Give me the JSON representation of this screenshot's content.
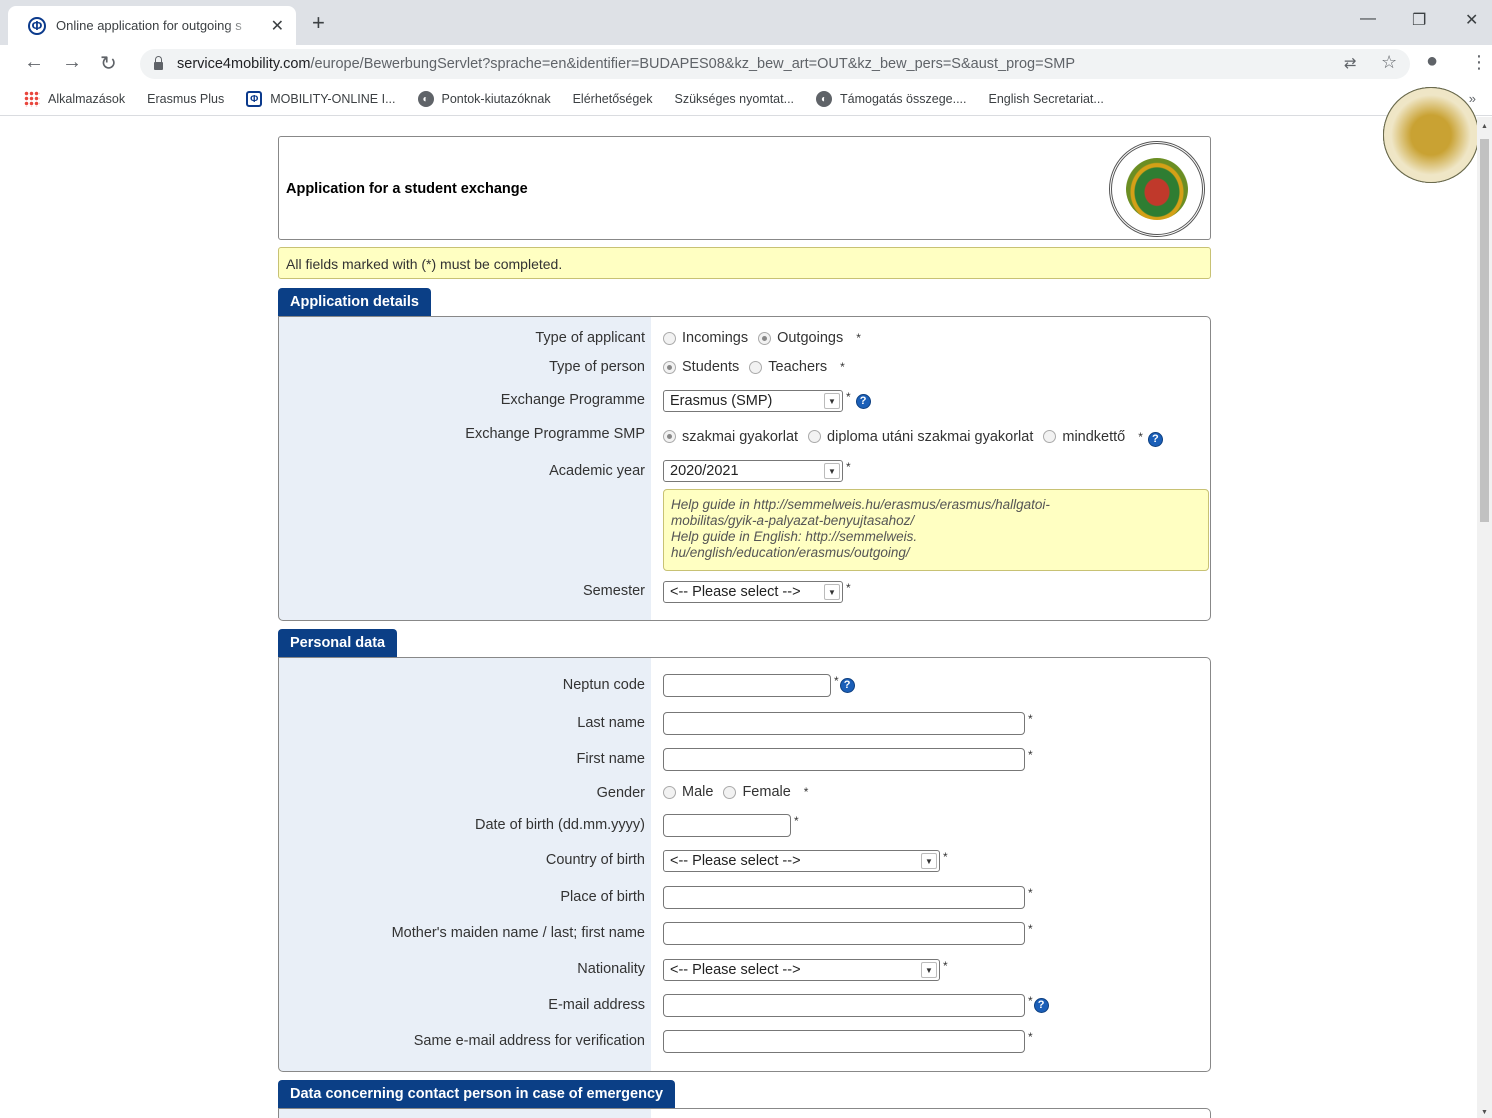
{
  "browser": {
    "tab_title": "Online application for outgoing s",
    "tab_favicon": "Φ",
    "url_domain": "service4mobility.com",
    "url_path": "/europe/BewerbungServlet?sprache=en&identifier=BUDAPES08&kz_bew_art=OUT&kz_bew_pers=S&aust_prog=SMP",
    "bookmarks": [
      {
        "label": "Alkalmazások",
        "icon": "apps-icon"
      },
      {
        "label": "Erasmus Plus",
        "icon": "seal-icon"
      },
      {
        "label": "MOBILITY-ONLINE I...",
        "icon": "mobility-online-icon"
      },
      {
        "label": "Pontok-kiutazóknak",
        "icon": "globe-icon"
      },
      {
        "label": "Elérhetőségek",
        "icon": "seal-icon"
      },
      {
        "label": "Szükséges nyomtat...",
        "icon": "seal-icon"
      },
      {
        "label": "Támogatás összege....",
        "icon": "globe-icon"
      },
      {
        "label": "English Secretariat...",
        "icon": "seal-icon"
      }
    ],
    "bookmarks_more": "»"
  },
  "header": {
    "title": "Application for a student exchange"
  },
  "notice": "All fields marked with (*) must be completed.",
  "application_details": {
    "tab_label": "Application details",
    "type_of_applicant": {
      "label": "Type of applicant",
      "options": [
        "Incomings",
        "Outgoings"
      ],
      "selected": "Outgoings"
    },
    "type_of_person": {
      "label": "Type of person",
      "options": [
        "Students",
        "Teachers"
      ],
      "selected": "Students"
    },
    "exchange_programme": {
      "label": "Exchange Programme",
      "value": "Erasmus (SMP)"
    },
    "exchange_programme_smp": {
      "label": "Exchange Programme SMP",
      "options": [
        "szakmai gyakorlat",
        "diploma utáni szakmai gyakorlat",
        "mindkettő"
      ],
      "selected": "szakmai gyakorlat"
    },
    "academic_year": {
      "label": "Academic year",
      "value": "2020/2021"
    },
    "help_text": [
      "Help guide in http://semmelweis.hu/erasmus/erasmus/hallgatoi-",
      "mobilitas/gyik-a-palyazat-benyujtasahoz/",
      "Help guide in English: http://semmelweis.",
      "hu/english/education/erasmus/outgoing/"
    ],
    "semester": {
      "label": "Semester",
      "value": "<-- Please select -->"
    }
  },
  "personal_data": {
    "tab_label": "Personal data",
    "neptun_code": {
      "label": "Neptun code",
      "value": ""
    },
    "last_name": {
      "label": "Last name",
      "value": ""
    },
    "first_name": {
      "label": "First name",
      "value": ""
    },
    "gender": {
      "label": "Gender",
      "options": [
        "Male",
        "Female"
      ],
      "selected": ""
    },
    "date_of_birth": {
      "label": "Date of birth (dd.mm.yyyy)",
      "value": ""
    },
    "country_of_birth": {
      "label": "Country of birth",
      "value": "<-- Please select -->"
    },
    "place_of_birth": {
      "label": "Place of birth",
      "value": ""
    },
    "mothers_maiden_name": {
      "label": "Mother's maiden name / last; first name",
      "value": ""
    },
    "nationality": {
      "label": "Nationality",
      "value": "<-- Please select -->"
    },
    "email": {
      "label": "E-mail address",
      "value": ""
    },
    "email_verify": {
      "label": "Same e-mail address for verification",
      "value": ""
    }
  },
  "emergency_contact": {
    "tab_label": "Data concerning contact person in case of emergency"
  },
  "required_mark": "*",
  "help_icon_glyph": "?"
}
